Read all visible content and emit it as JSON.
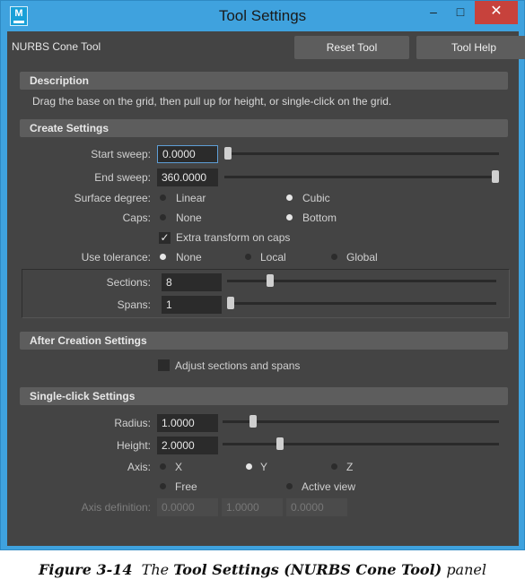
{
  "window": {
    "title": "Tool Settings",
    "minimize_glyph": "–",
    "maximize_glyph": "□",
    "close_glyph": "✕",
    "app_icon_letter": "M"
  },
  "header": {
    "tool_name": "NURBS Cone Tool",
    "reset_label": "Reset Tool",
    "help_label": "Tool Help"
  },
  "description": {
    "header": "Description",
    "text": "Drag the base on the grid, then pull up for height, or single-click on the grid."
  },
  "create_settings": {
    "header": "Create Settings",
    "start_sweep": {
      "label": "Start sweep:",
      "value": "0.0000",
      "slider_fraction": 0.0
    },
    "end_sweep": {
      "label": "End sweep:",
      "value": "360.0000",
      "slider_fraction": 1.0
    },
    "surface_degree": {
      "label": "Surface degree:",
      "options": [
        "Linear",
        "Cubic"
      ],
      "selected": "Cubic"
    },
    "caps": {
      "label": "Caps:",
      "options": [
        "None",
        "Bottom"
      ],
      "selected": "Bottom"
    },
    "extra_transform": {
      "label": "Extra transform on caps",
      "checked": true,
      "check_glyph": "✓"
    },
    "use_tolerance": {
      "label": "Use tolerance:",
      "options": [
        "None",
        "Local",
        "Global"
      ],
      "selected": "None"
    },
    "sections": {
      "label": "Sections:",
      "value": "8",
      "slider_fraction": 0.15
    },
    "spans": {
      "label": "Spans:",
      "value": "1",
      "slider_fraction": 0.0
    }
  },
  "after_creation": {
    "header": "After Creation Settings",
    "adjust": {
      "label": "Adjust sections and spans",
      "checked": false
    }
  },
  "single_click": {
    "header": "Single-click Settings",
    "radius": {
      "label": "Radius:",
      "value": "1.0000",
      "slider_fraction": 0.1
    },
    "height": {
      "label": "Height:",
      "value": "2.0000",
      "slider_fraction": 0.2
    },
    "axis": {
      "label": "Axis:",
      "options": [
        "X",
        "Y",
        "Z",
        "Free",
        "Active view"
      ],
      "selected": "Y"
    },
    "axis_definition": {
      "label": "Axis definition:",
      "values": [
        "0.0000",
        "1.0000",
        "0.0000"
      ]
    }
  },
  "caption": {
    "figure": "Figure 3-14",
    "pre": "The",
    "bold": "Tool Settings (NURBS Cone Tool)",
    "post": "panel"
  }
}
